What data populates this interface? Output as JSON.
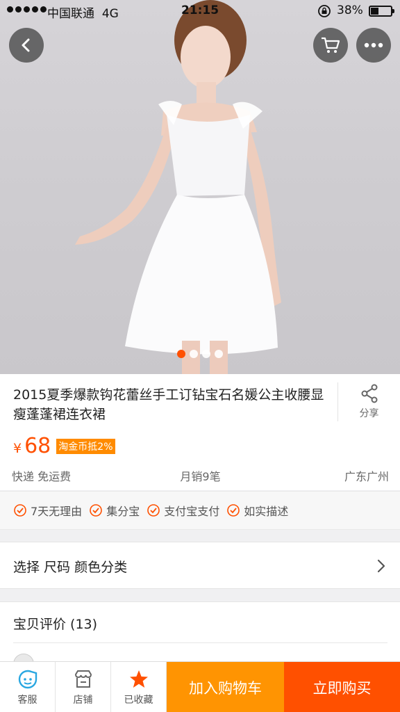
{
  "status_bar": {
    "carrier": "中国联通",
    "network": "4G",
    "time": "21:15",
    "battery_percent_text": "38%",
    "battery_level": 0.38
  },
  "hero": {
    "image_count": 4,
    "active_index": 0
  },
  "product": {
    "title": "2015夏季爆款钩花蕾丝手工订钻宝石名媛公主收腰显瘦蓬蓬裙连衣裙",
    "share_label": "分享",
    "currency": "¥",
    "price": "68",
    "coin_tag": "淘金币抵2%",
    "shipping": "快递 免运费",
    "monthly_sales": "月销9笔",
    "location": "广东广州"
  },
  "guarantees": [
    {
      "label": "7天无理由"
    },
    {
      "label": "集分宝"
    },
    {
      "label": "支付宝支付"
    },
    {
      "label": "如实描述"
    }
  ],
  "options": {
    "label": "选择 尺码 颜色分类"
  },
  "reviews": {
    "heading": "宝贝评价 (13)"
  },
  "bottom_bar": {
    "service_label": "客服",
    "shop_label": "店铺",
    "favorite_label": "已收藏",
    "add_to_cart_label": "加入购物车",
    "buy_now_label": "立即购买"
  },
  "colors": {
    "accent": "#ff5000",
    "cart_button": "#ff9402",
    "coin_tag": "#ff8b00",
    "service_icon": "#29a7e1"
  },
  "icons": {
    "back": "chevron-left-icon",
    "cart": "cart-icon",
    "more": "more-icon",
    "share": "share-icon",
    "check": "check-circle-icon",
    "chevron": "chevron-right-icon",
    "service": "service-icon",
    "shop": "shop-icon",
    "favorite": "star-icon"
  }
}
